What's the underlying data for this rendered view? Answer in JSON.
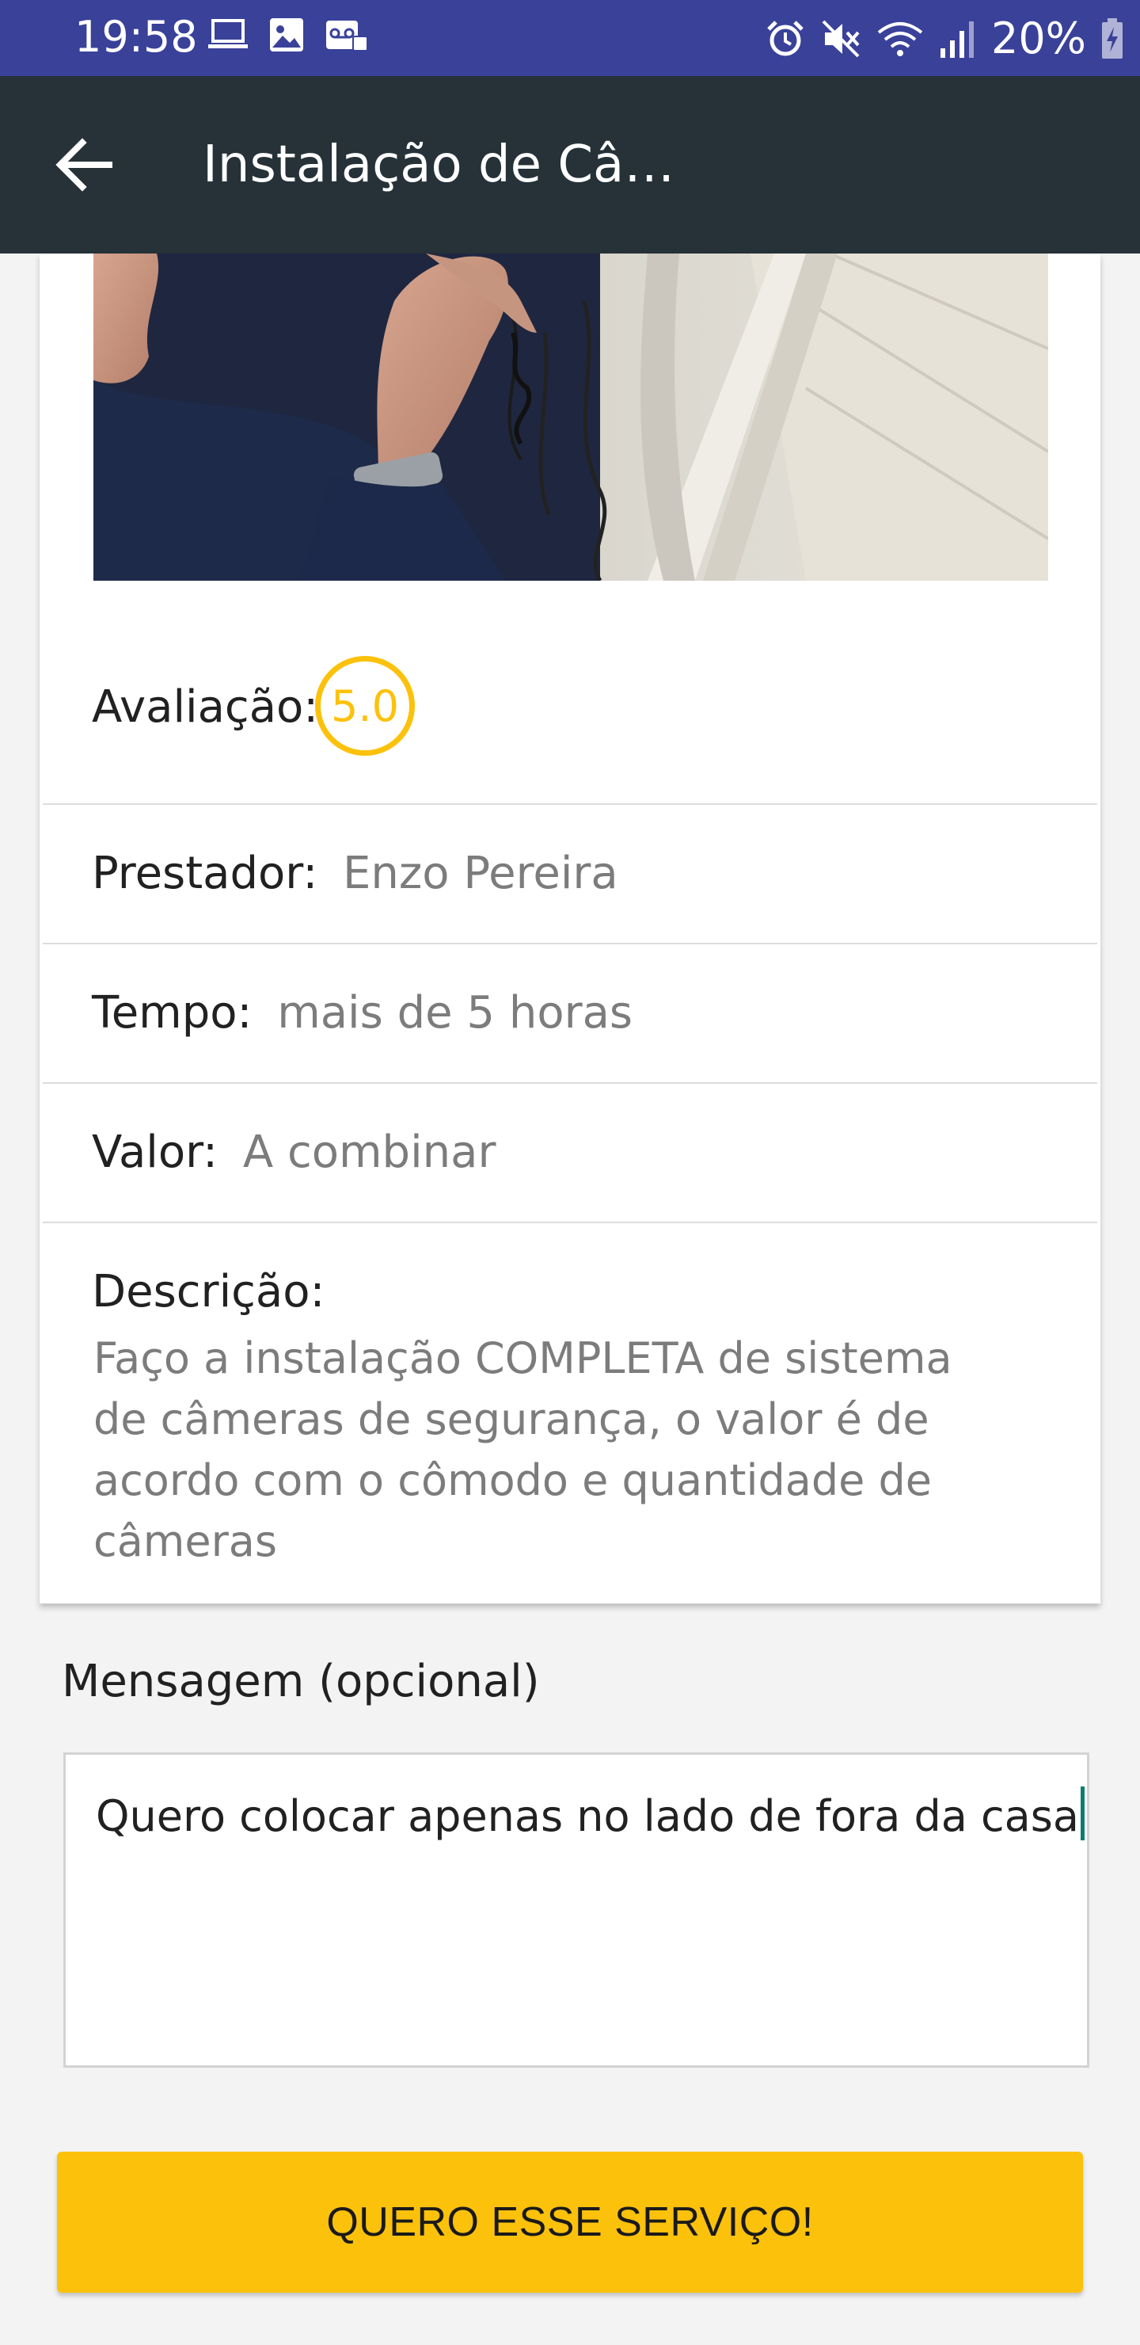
{
  "status_bar": {
    "time": "19:58",
    "battery": "20%",
    "left_icons": [
      "laptop-icon",
      "image-icon",
      "voicemail-icon"
    ],
    "right_icons": [
      "alarm-icon",
      "mute-icon",
      "wifi-icon",
      "signal-icon",
      "battery-charging-icon"
    ]
  },
  "app_bar": {
    "title": "Instalação de Câ…",
    "back_icon": "arrow-back-icon"
  },
  "service": {
    "rating_label": "Avaliação:",
    "rating_value": "5.0",
    "provider_label": "Prestador:",
    "provider_value": "Enzo Pereira",
    "time_label": "Tempo:",
    "time_value": "mais de 5 horas",
    "price_label": "Valor:",
    "price_value": "A combinar",
    "description_label": "Descrição:",
    "description_lines": [
      "Faço a instalação COMPLETA de sistema",
      "de câmeras de segurança, o valor é de",
      "acordo com o cômodo e quantidade de",
      "câmeras"
    ]
  },
  "message": {
    "label": "Mensagem (opcional)",
    "value": "Quero colocar apenas no lado de fora da casa"
  },
  "cta": {
    "label": "QUERO ESSE SERVIÇO!"
  },
  "colors": {
    "status_bar": "#3a4199",
    "app_bar": "#263238",
    "accent": "#fcc10b",
    "cursor": "#0a7d6e"
  }
}
